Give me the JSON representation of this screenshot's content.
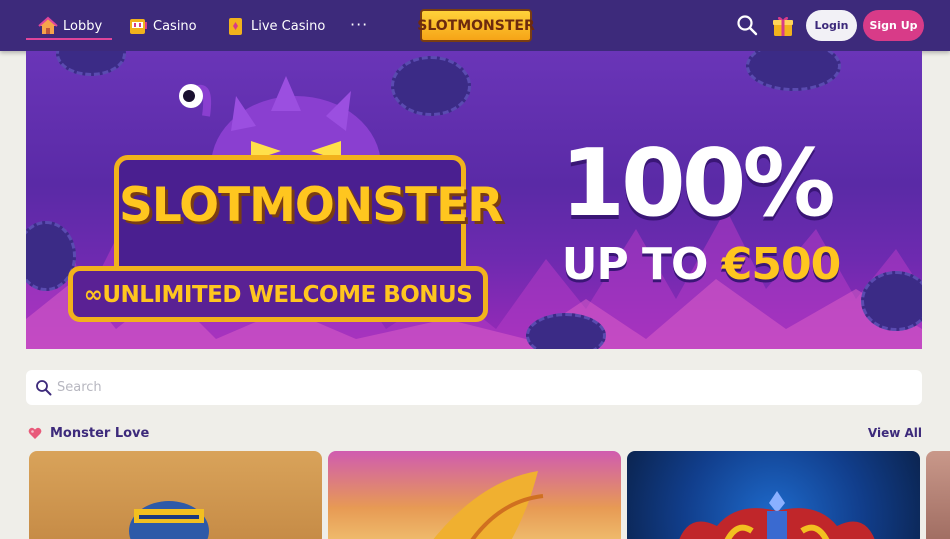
{
  "nav": {
    "lobby": "Lobby",
    "casino": "Casino",
    "live_casino": "Live Casino",
    "more": "···"
  },
  "logo": {
    "text": "SLOTMONSTER"
  },
  "header": {
    "login": "Login",
    "signup": "Sign Up"
  },
  "banner": {
    "brand": "SLOTMONSTER",
    "bonus": "∞UNLIMITED WELCOME BONUS",
    "percent": "100%",
    "upto_prefix": "UP TO ",
    "upto_amount": "€500"
  },
  "search": {
    "placeholder": "Search",
    "value": ""
  },
  "section": {
    "title": "Monster Love",
    "view_all": "View All"
  },
  "colors": {
    "header_bg": "#3d2a7b",
    "accent_pink": "#d83b88",
    "brand_yellow": "#ffc61f",
    "page_bg": "#efeee9"
  },
  "icons": {
    "lobby": "house-icon",
    "casino": "slot-machine-icon",
    "live_casino": "card-icon",
    "search": "search-icon",
    "gift": "gift-icon",
    "section": "heart-icon"
  }
}
